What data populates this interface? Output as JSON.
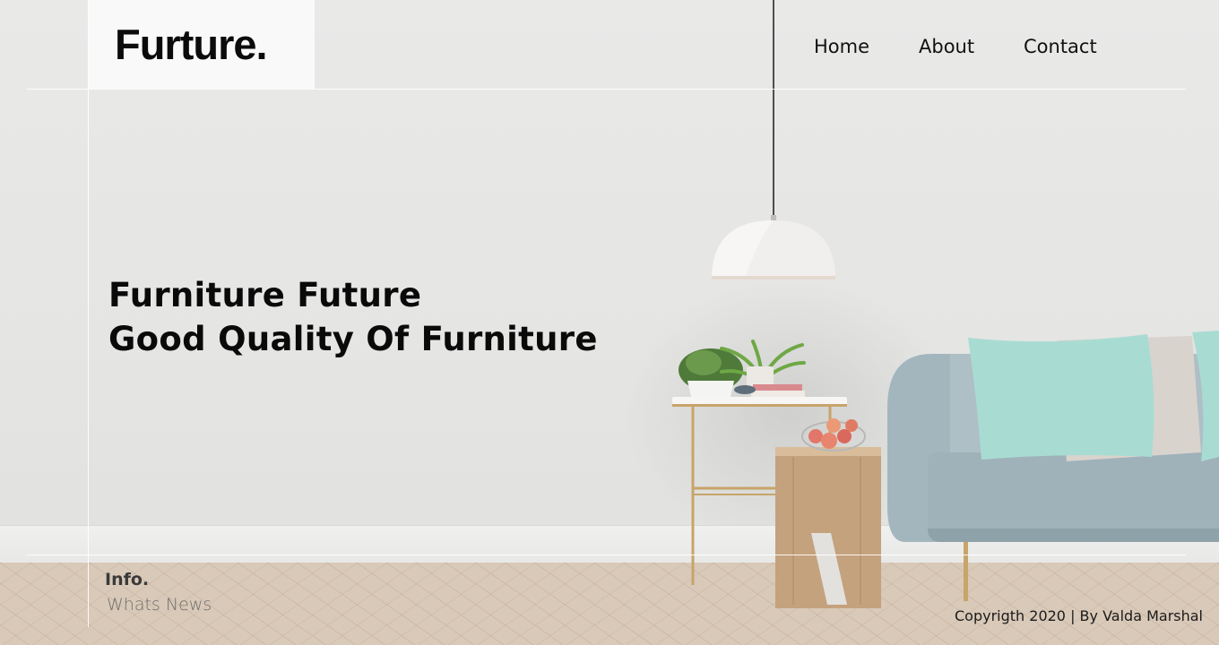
{
  "brand": {
    "logo": "Furture."
  },
  "nav": {
    "items": [
      "Home",
      "About",
      "Contact"
    ]
  },
  "hero": {
    "line1": "Furniture Future",
    "line2": "Good Quality Of Furniture"
  },
  "info": {
    "title": "Info.",
    "subtitle": "Whats News"
  },
  "footer": {
    "copyright": "Copyrigth 2020 |  By Valda Marshal"
  },
  "colors": {
    "wall": "#e7e7e5",
    "floor": "#d9c9b8",
    "sofa": "#aebfc6",
    "pillow": "#a8dcd3",
    "brass": "#c7a46a",
    "text": "#0a0a0a"
  },
  "icons": [
    "pendant-lamp-illustration",
    "side-table-illustration",
    "sofa-illustration"
  ]
}
